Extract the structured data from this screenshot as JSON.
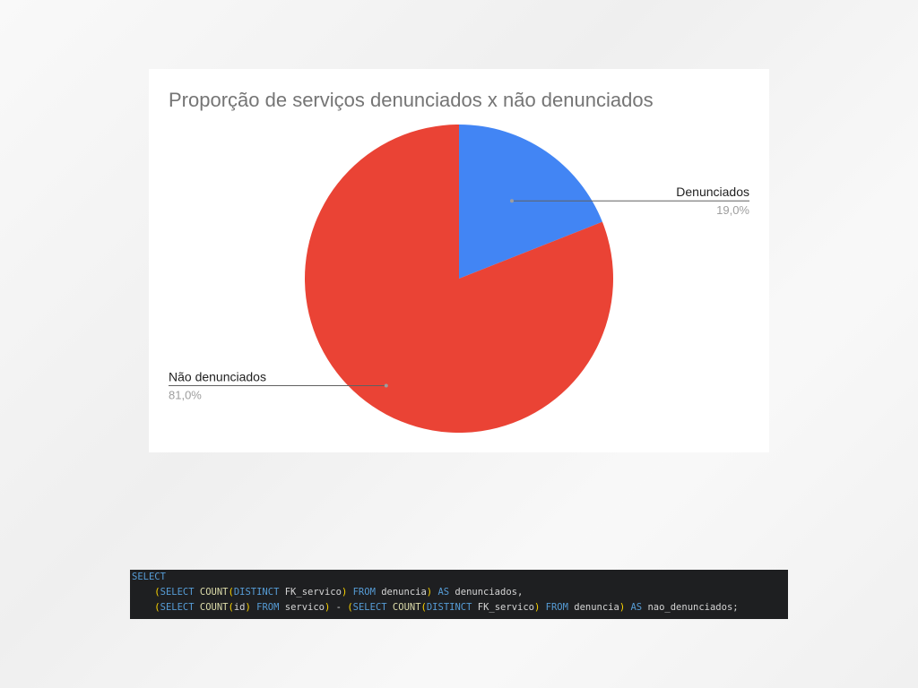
{
  "chart_data": {
    "type": "pie",
    "title": "Proporção de serviços denunciados x não denunciados",
    "slices": [
      {
        "label": "Denunciados",
        "value": 19.0,
        "value_label": "19,0%",
        "color": "#4285f4"
      },
      {
        "label": "Não denunciados",
        "value": 81.0,
        "value_label": "81,0%",
        "color": "#ea4335"
      }
    ],
    "legend": "none",
    "labels": "outside-with-leader-lines"
  },
  "code": {
    "line1": [
      {
        "t": "SELECT",
        "c": "kw"
      }
    ],
    "line2": [
      {
        "t": "    ",
        "c": "txt"
      },
      {
        "t": "(",
        "c": "par"
      },
      {
        "t": "SELECT ",
        "c": "kw"
      },
      {
        "t": "COUNT",
        "c": "fn"
      },
      {
        "t": "(",
        "c": "par"
      },
      {
        "t": "DISTINCT ",
        "c": "kw"
      },
      {
        "t": "FK_servico",
        "c": "txt"
      },
      {
        "t": ") ",
        "c": "par"
      },
      {
        "t": "FROM ",
        "c": "kw"
      },
      {
        "t": "denuncia",
        "c": "txt"
      },
      {
        "t": ") ",
        "c": "par"
      },
      {
        "t": "AS ",
        "c": "kw"
      },
      {
        "t": "denunciados,",
        "c": "txt"
      }
    ],
    "line3": [
      {
        "t": "    ",
        "c": "txt"
      },
      {
        "t": "(",
        "c": "par"
      },
      {
        "t": "SELECT ",
        "c": "kw"
      },
      {
        "t": "COUNT",
        "c": "fn"
      },
      {
        "t": "(",
        "c": "par"
      },
      {
        "t": "id",
        "c": "txt"
      },
      {
        "t": ") ",
        "c": "par"
      },
      {
        "t": "FROM ",
        "c": "kw"
      },
      {
        "t": "servico",
        "c": "txt"
      },
      {
        "t": ") ",
        "c": "par"
      },
      {
        "t": "- ",
        "c": "txt"
      },
      {
        "t": "(",
        "c": "par"
      },
      {
        "t": "SELECT ",
        "c": "kw"
      },
      {
        "t": "COUNT",
        "c": "fn"
      },
      {
        "t": "(",
        "c": "par"
      },
      {
        "t": "DISTINCT ",
        "c": "kw"
      },
      {
        "t": "FK_servico",
        "c": "txt"
      },
      {
        "t": ") ",
        "c": "par"
      },
      {
        "t": "FROM ",
        "c": "kw"
      },
      {
        "t": "denuncia",
        "c": "txt"
      },
      {
        "t": ") ",
        "c": "par"
      },
      {
        "t": "AS ",
        "c": "kw"
      },
      {
        "t": "nao_denunciados;",
        "c": "txt"
      }
    ]
  }
}
